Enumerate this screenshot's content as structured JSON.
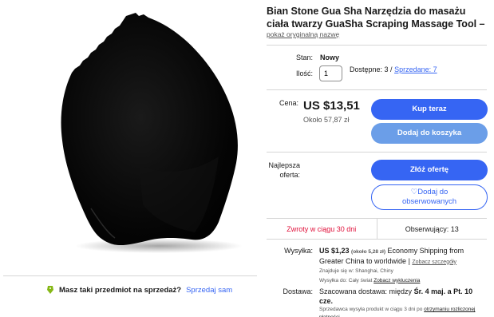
{
  "product": {
    "title": "Bian Stone Gua Sha Narzędzia do masażu ciała twarzy GuaSha Scraping Massage Tool –",
    "original_name_link": "pokaż oryginalną nazwę"
  },
  "condition": {
    "label": "Stan:",
    "value": "Nowy"
  },
  "quantity": {
    "label": "Ilość:",
    "value": "1",
    "available": "Dostępne: 3 /",
    "sold_link": "Sprzedane: 7"
  },
  "price": {
    "label": "Cena:",
    "value": "US $13,51",
    "approx": "Około 57,87 zł"
  },
  "buttons": {
    "buy_now": "Kup teraz",
    "add_to_cart": "Dodaj do koszyka",
    "make_offer": "Złóż ofertę",
    "add_to_watchlist_line1": "Dodaj do",
    "add_to_watchlist_line2": "obserwowanych"
  },
  "best_offer": {
    "label_line1": "Najlepsza",
    "label_line2": "oferta:"
  },
  "returns": {
    "text": "Zwroty w ciągu 30 dni"
  },
  "watchers": {
    "text": "Obserwujący: 13"
  },
  "shipping": {
    "label": "Wysyłka:",
    "price": "US $1,23",
    "price_approx": "(około 5,28 zł)",
    "method": "Economy Shipping from Greater China to worldwide",
    "details_link": "Zobacz szczegóły",
    "location": "Znajduje się w:  Shanghai, Chiny",
    "ships_to": "Wysyłka do:  Cały świat",
    "exclusions_link": "Zobacz wykluczenia"
  },
  "delivery": {
    "label": "Dostawa:",
    "estimate_prefix": "Szacowana dostawa: między",
    "estimate_dates": "Śr. 4 maj. a Pt. 10 cze.",
    "note": "Sprzedawca wysyła produkt w ciągu 3 dni po",
    "note_link": "otrzymaniu rozliczonej płatności",
    "note_end": "."
  },
  "sell_bar": {
    "text": "Masz taki przedmiot na sprzedaż?",
    "link": "Sprzedaj sam"
  },
  "colors": {
    "accent": "#3665f3",
    "returns_red": "#e0103a",
    "secondary_button": "#6b9ee8"
  }
}
